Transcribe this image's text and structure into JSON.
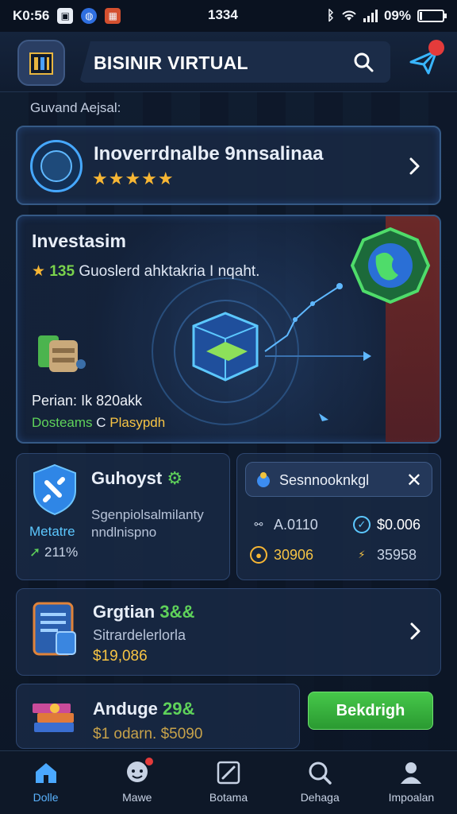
{
  "status_bar": {
    "time": "K0:56",
    "clock": "1334",
    "battery": "09%",
    "battery_level": 0.09
  },
  "header": {
    "app_title": "BISINIR VIRTUAL"
  },
  "section_label": "Guvand Aejsal:",
  "featured": {
    "name": "Inoverrdnalbe 9nnsalinaa",
    "rating_stars": 5
  },
  "invest": {
    "heading": "Investasim",
    "rating": "135",
    "rating_text": "Guoslerd ahktakria I nqaht.",
    "price_label": "Perian:",
    "price_value": "Ik 820akk",
    "meta_green": "Dosteams",
    "meta_letter": "C",
    "meta_yellow": "Plasypdh"
  },
  "guhoyst": {
    "name": "Guhoyst",
    "desc_line1": "Sgenpiolsalmilanty",
    "desc_line2": "nndlnispno",
    "meta": "Metatre",
    "pct": "211%"
  },
  "stats": {
    "search_text": "Sesnnooknkgl",
    "items": [
      {
        "value": "A.0110",
        "color": "#c9d4e6"
      },
      {
        "value": "$0.006",
        "color": "#ffffff"
      },
      {
        "value": "30906",
        "color": "#f7c444"
      },
      {
        "value": "35958",
        "color": "#c9d4e6"
      }
    ]
  },
  "grgtian": {
    "name": "Grgtian",
    "badge": "3&&",
    "sub": "Sitrardelerlorla",
    "price": "$19,086"
  },
  "anduge": {
    "name": "Anduge",
    "badge": "29&",
    "price": "$1 odarn. $5090"
  },
  "cta_label": "Bekdrigh",
  "nav": [
    {
      "label": "Dolle",
      "icon": "home-icon",
      "active": true
    },
    {
      "label": "Mawe",
      "icon": "chat-icon",
      "active": false
    },
    {
      "label": "Botama",
      "icon": "edit-icon",
      "active": false
    },
    {
      "label": "Dehaga",
      "icon": "search-icon",
      "active": false
    },
    {
      "label": "Impoalan",
      "icon": "profile-icon",
      "active": false
    }
  ],
  "colors": {
    "accent_blue": "#46a8ff",
    "accent_green": "#5fd25a",
    "accent_gold": "#f7b634",
    "badge_red": "#e43b3b"
  }
}
